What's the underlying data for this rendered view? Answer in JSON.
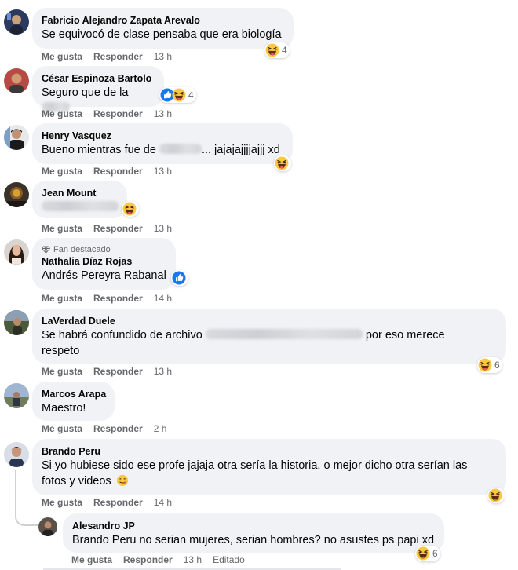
{
  "labels": {
    "like": "Me gusta",
    "reply": "Responder",
    "edited": "Editado"
  },
  "comments": [
    {
      "author": "Fabricio Alejandro Zapata Arevalo",
      "text": "Se equivocó de clase pensaba que era biología",
      "time": "13 h",
      "reactions": {
        "icons": [
          "haha-icon"
        ],
        "count": "4"
      }
    },
    {
      "author": "César Espinoza Bartolo",
      "text": "Seguro que de la",
      "time": "13 h",
      "reactions": {
        "icons": [
          "like-icon",
          "haha-icon"
        ],
        "count": "4"
      }
    },
    {
      "author": "Henry Vasquez",
      "text_before": "Bueno mientras fue de",
      "text_after": "... jajajajjjjajjj xd",
      "time": "13 h",
      "reactions": {
        "icons": [
          "haha-icon"
        ],
        "count": ""
      }
    },
    {
      "author": "Jean Mount",
      "time": "13 h",
      "reactions": {
        "icons": [
          "haha-icon"
        ],
        "count": ""
      }
    },
    {
      "badge": "Fan destacado",
      "author": "Nathalia Díaz Rojas",
      "text": "Andrés Pereyra Rabanal",
      "time": "14 h",
      "reactions": {
        "icons": [
          "like-icon"
        ],
        "count": ""
      }
    },
    {
      "author": "LaVerdad Duele",
      "text_before": "Se habrá confundido de archivo",
      "text_after": "por eso merece",
      "text_line2": "respeto",
      "time": "13 h",
      "reactions": {
        "icons": [
          "haha-icon"
        ],
        "count": "6"
      }
    },
    {
      "author": "Marcos Arapa",
      "text": "Maestro!",
      "time": "2 h"
    },
    {
      "author": "Brando Peru",
      "text_line1": "Si yo hubiese sido ese profe jajaja otra sería la historia, o mejor dicho otra serían las",
      "text_line2": "fotos y videos",
      "time": "14 h",
      "reactions": {
        "icons": [
          "haha-icon"
        ],
        "count": ""
      }
    }
  ],
  "reply": {
    "author": "Alesandro JP",
    "text": "Brando Peru no serian mujeres, serian hombres? no asustes ps papi xd",
    "time": "13 h",
    "reactions": {
      "icons": [
        "haha-icon"
      ],
      "count": "6"
    }
  },
  "colors": {
    "bubble": "#f0f2f5",
    "meta": "#65676b",
    "like_blue": "#1877f2",
    "haha_yellow": "#fcc844"
  }
}
